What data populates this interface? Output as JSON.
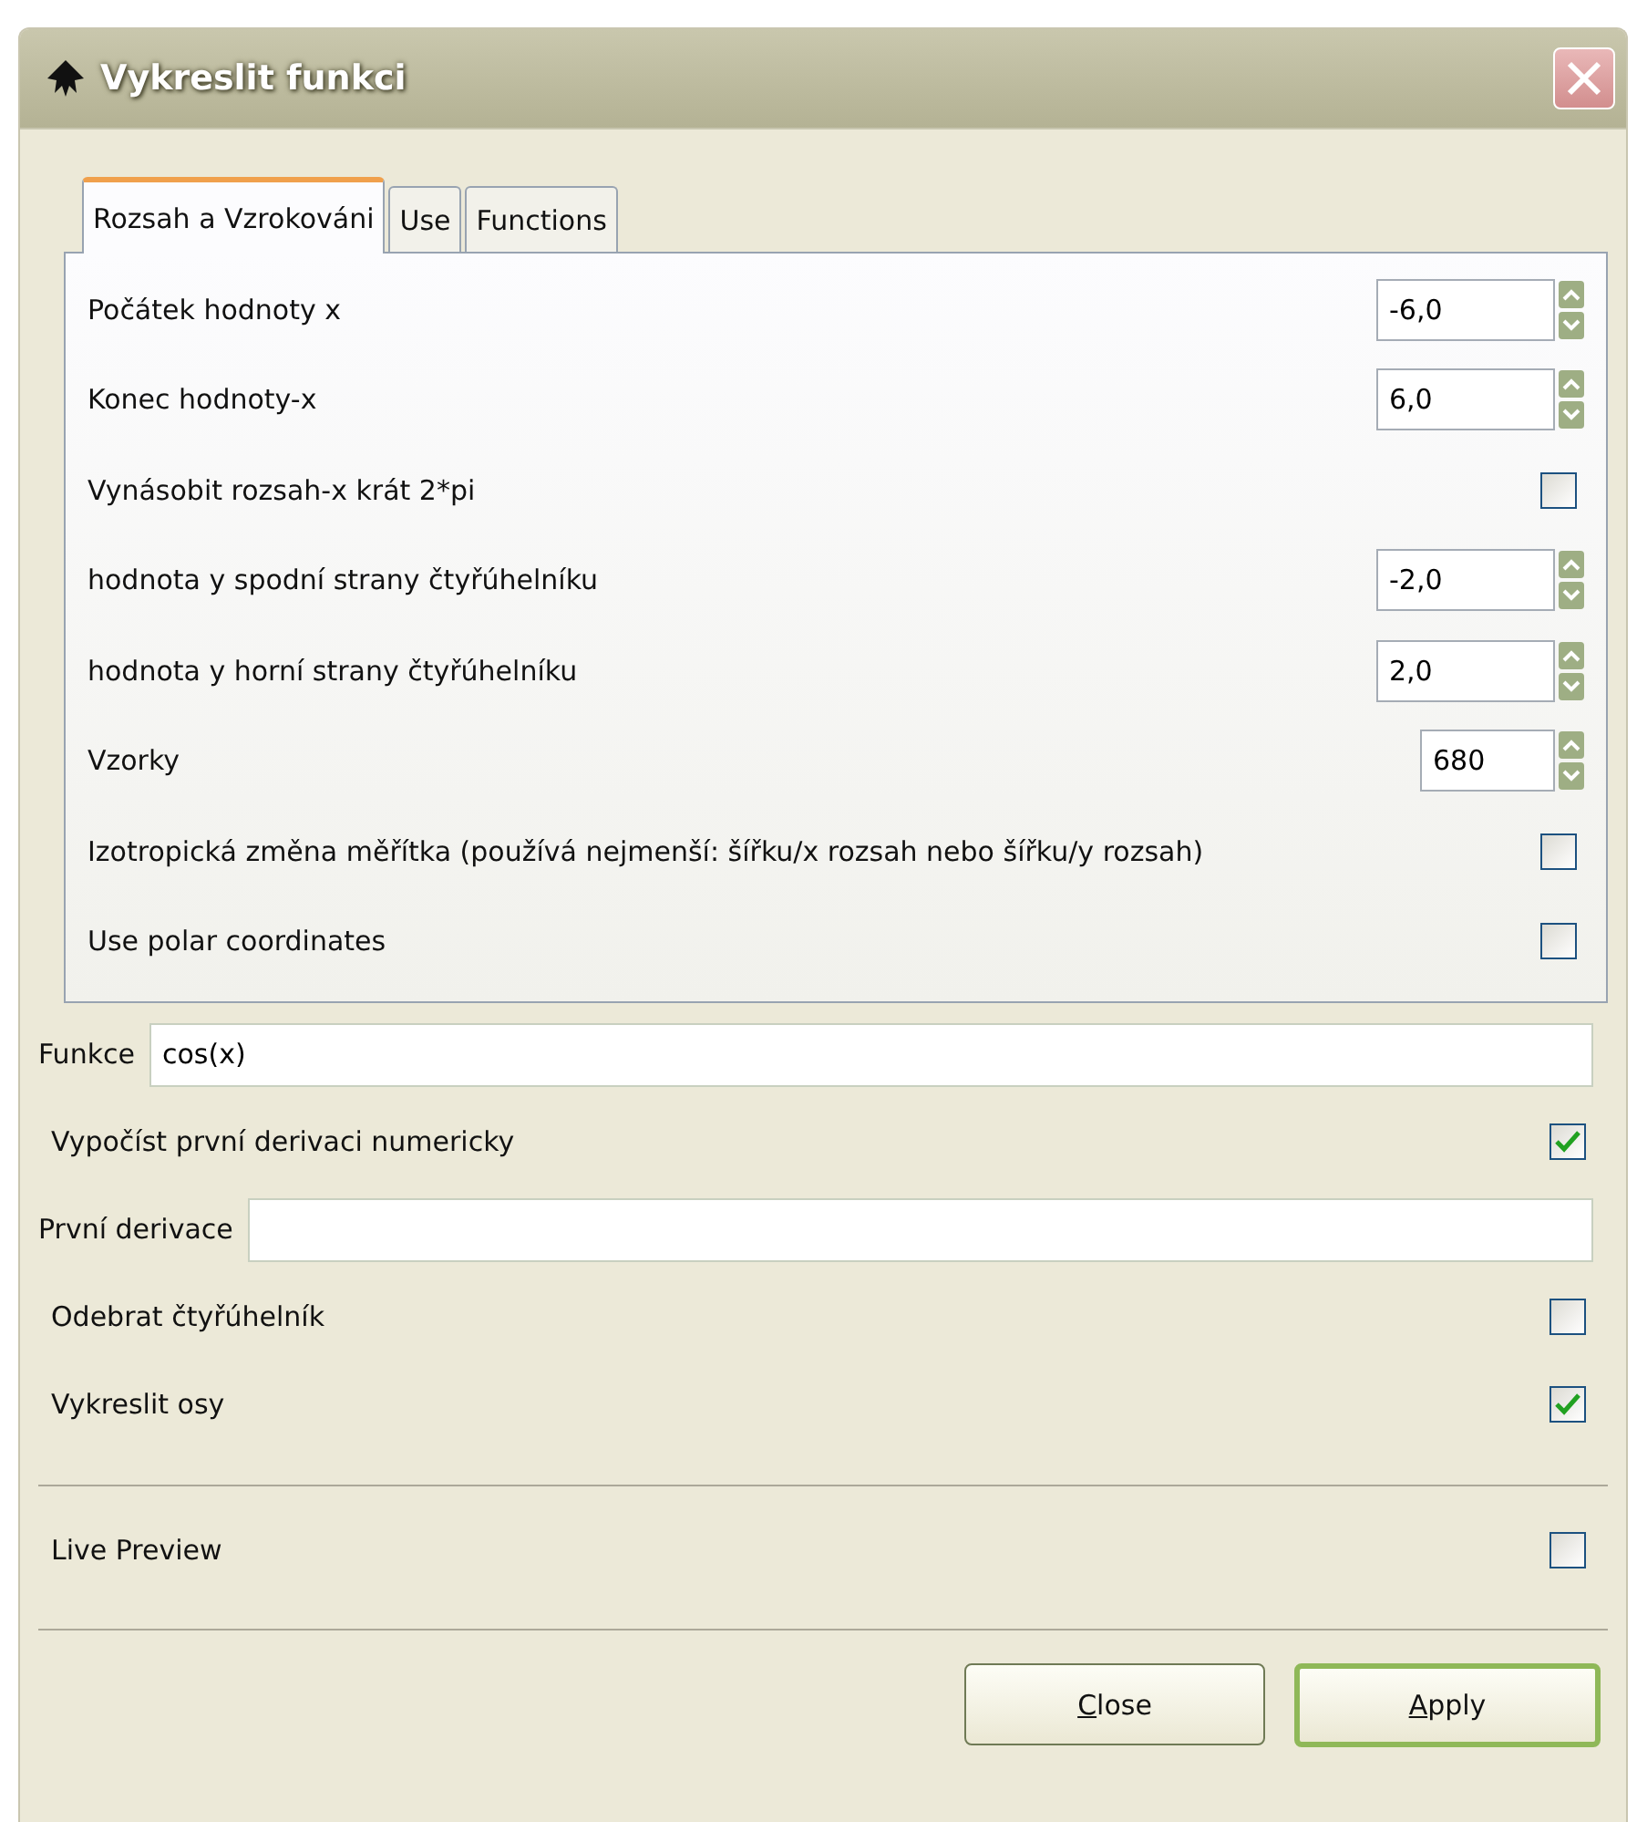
{
  "window": {
    "title": "Vykreslit funkci"
  },
  "tabs": [
    {
      "label": "Rozsah a Vzrokováni",
      "selected": true
    },
    {
      "label": "Use",
      "selected": false
    },
    {
      "label": "Functions",
      "selected": false
    }
  ],
  "tab_rows": [
    {
      "kind": "spin",
      "label": "Počátek hodnoty x",
      "value": "-6,0"
    },
    {
      "kind": "spin",
      "label": "Konec hodnoty-x",
      "value": "6,0"
    },
    {
      "kind": "checkbox",
      "label": "Vynásobit rozsah-x krát 2*pi",
      "checked": false
    },
    {
      "kind": "spin",
      "label": "hodnota y spodní strany čtyřúhelníku",
      "value": "-2,0"
    },
    {
      "kind": "spin",
      "label": "hodnota y horní strany čtyřúhelníku",
      "value": "2,0"
    },
    {
      "kind": "spin",
      "label": "Vzorky",
      "value": "680"
    },
    {
      "kind": "checkbox",
      "label": "Izotropická změna měřítka (používá nejmenší: šířku/x rozsah nebo šířku/y rozsah)",
      "checked": false
    },
    {
      "kind": "checkbox",
      "label": "Use polar coordinates",
      "checked": false
    }
  ],
  "rows": [
    {
      "kind": "text",
      "label": "Funkce",
      "value": "cos(x)"
    },
    {
      "kind": "checkbox",
      "label": "Vypočíst první derivaci numericky",
      "checked": true
    },
    {
      "kind": "text",
      "label": "První derivace"
    },
    {
      "kind": "checkbox",
      "label": "Odebrat čtyřúhelník",
      "checked": false
    },
    {
      "kind": "checkbox",
      "label": "Vykreslit osy",
      "checked": true
    }
  ],
  "live_preview": {
    "label": "Live Preview",
    "checked": false
  },
  "buttons": [
    {
      "label": "Close",
      "default": false
    },
    {
      "label": "Apply",
      "default": true
    }
  ]
}
